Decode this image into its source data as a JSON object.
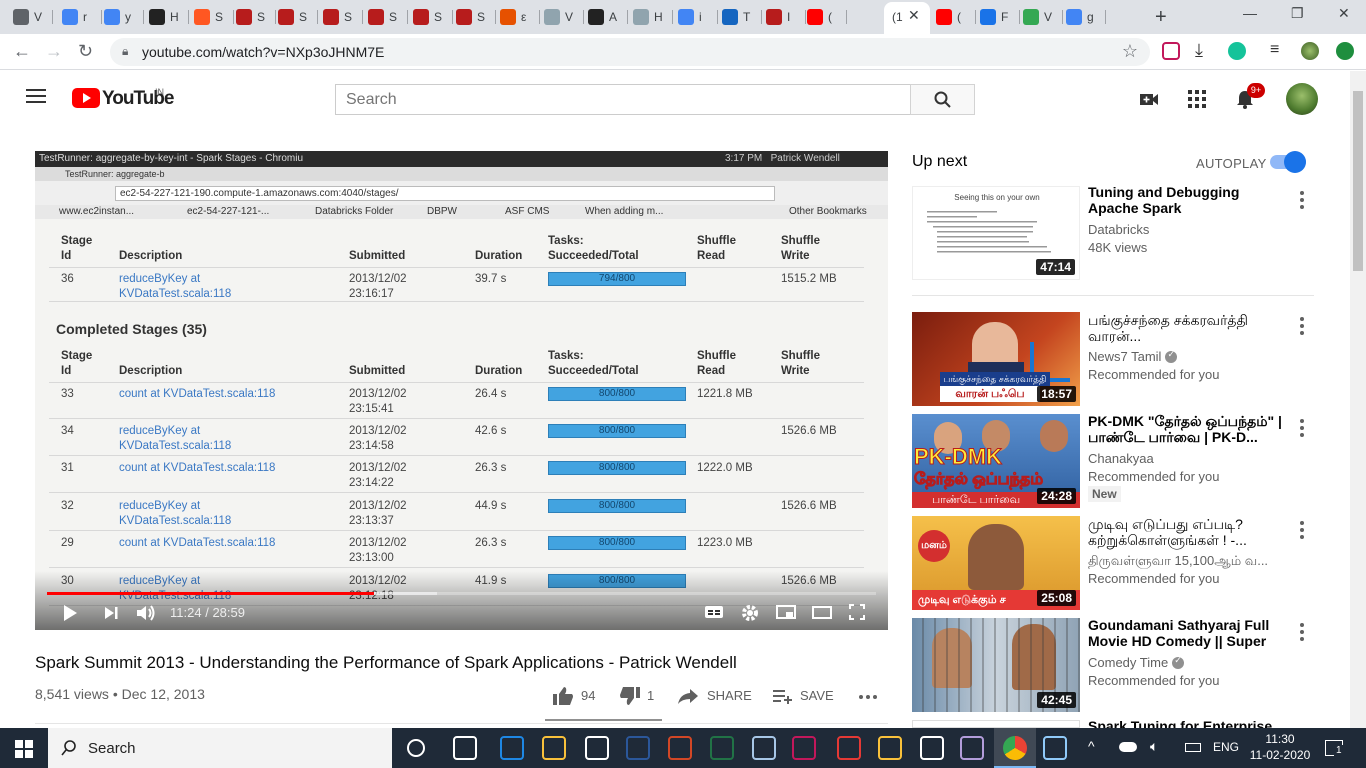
{
  "browser": {
    "active_tab_prefix": "(1",
    "tab_title_glyphs": [
      "V",
      "r",
      "y",
      "H",
      "S",
      "S",
      "S",
      "S",
      "S",
      "S",
      "S",
      "ε",
      "V",
      "A",
      "H",
      "i",
      "T",
      "I",
      "(",
      "(",
      "(",
      "F",
      "V",
      "g"
    ],
    "url": "youtube.com/watch?v=NXp3oJHNM7E"
  },
  "youtube": {
    "logo_text": "YouTube",
    "region": "IN",
    "search_placeholder": "Search",
    "notification_count": "9+"
  },
  "video": {
    "screen": {
      "window_title": "TestRunner: aggregate-by-key-int - Spark Stages - Chromiu",
      "clock": "3:17 PM",
      "user": "Patrick Wendell",
      "tab": "TestRunner: aggregate-b",
      "url": "ec2-54-227-121-190.compute-1.amazonaws.com:4040/stages/",
      "bookmarks": [
        "www.ec2instan...",
        "ec2-54-227-121-...",
        "Databricks Folder",
        "DBPW",
        "ASF CMS",
        "When adding m...",
        "Other Bookmarks"
      ],
      "headers": [
        "Stage Id",
        "Description",
        "Submitted",
        "Duration",
        "Tasks: Succeeded/Total",
        "Shuffle Read",
        "Shuffle Write"
      ],
      "active_row": {
        "id": "36",
        "desc": "reduceByKey at KVDataTest.scala:118",
        "submitted": "2013/12/02 23:16:17",
        "duration": "39.7 s",
        "tasks": "794/800",
        "read": "",
        "write": "1515.2 MB"
      },
      "completed_title": "Completed Stages (35)",
      "rows": [
        {
          "id": "33",
          "desc": "count at KVDataTest.scala:118",
          "submitted": "2013/12/02 23:15:41",
          "duration": "26.4 s",
          "tasks": "800/800",
          "read": "1221.8 MB",
          "write": ""
        },
        {
          "id": "34",
          "desc": "reduceByKey at KVDataTest.scala:118",
          "submitted": "2013/12/02 23:14:58",
          "duration": "42.6 s",
          "tasks": "800/800",
          "read": "",
          "write": "1526.6 MB"
        },
        {
          "id": "31",
          "desc": "count at KVDataTest.scala:118",
          "submitted": "2013/12/02 23:14:22",
          "duration": "26.3 s",
          "tasks": "800/800",
          "read": "1222.0 MB",
          "write": ""
        },
        {
          "id": "32",
          "desc": "reduceByKey at KVDataTest.scala:118",
          "submitted": "2013/12/02 23:13:37",
          "duration": "44.9 s",
          "tasks": "800/800",
          "read": "",
          "write": "1526.6 MB"
        },
        {
          "id": "29",
          "desc": "count at KVDataTest.scala:118",
          "submitted": "2013/12/02 23:13:00",
          "duration": "26.3 s",
          "tasks": "800/800",
          "read": "1223.0 MB",
          "write": ""
        },
        {
          "id": "30",
          "desc": "reduceByKey at KVDataTest.scala:118",
          "submitted": "2013/12/02 23:12:18",
          "duration": "41.9 s",
          "tasks": "800/800",
          "read": "",
          "write": "1526.6 MB"
        }
      ]
    },
    "progress_played_fraction": 0.394,
    "time_current": "11:24",
    "time_separator": "/",
    "time_total": "28:59",
    "title": "Spark Summit 2013 - Understanding the Performance of Spark Applications - Patrick Wendell",
    "views": "8,541 views",
    "meta_separator": "•",
    "date": "Dec 12, 2013",
    "likes": "94",
    "dislikes": "1",
    "share_label": "SHARE",
    "save_label": "SAVE"
  },
  "sidebar": {
    "up_next_label": "Up next",
    "autoplay_label": "AUTOPLAY",
    "autoplay_on": true,
    "first_thumb_heading": "Seeing this on your own",
    "items": [
      {
        "title": "Tuning and Debugging Apache Spark",
        "channel": "Databricks",
        "meta": "48K views",
        "duration": "47:14"
      },
      {
        "title": "பங்குச்சந்தை சக்கரவர்த்தி வாரன்...",
        "channel": "News7 Tamil",
        "meta": "Recommended for you",
        "duration": "18:57",
        "thumb_caption": "பங்குச்சந்தை சக்கரவர்த்தி",
        "thumb_caption2": "வாரன் பஃபெ"
      },
      {
        "title": "PK-DMK \"தேர்தல் ஒப்பந்தம்\" | பாண்டே பார்வை | PK-D...",
        "channel": "Chanakyaa",
        "meta": "Recommended for you",
        "badge": "New",
        "duration": "24:28",
        "thumb_caption": "PK-DMK",
        "thumb_caption2": "தேர்தல் ஒப்பந்தம்",
        "thumb_caption3": "பாண்டே பார்வை"
      },
      {
        "title": "முடிவு எடுப்பது எப்படி? கற்றுக்கொள்ளுங்கள் ! -...",
        "channel": "திருவள்ளுவா 15,100ஆம் வ...",
        "meta": "Recommended for you",
        "duration": "25:08",
        "thumb_caption": "மனம்",
        "thumb_caption2": "முடிவு எடுக்கும் ச"
      },
      {
        "title": "Goundamani Sathyaraj Full Movie HD Comedy || Super Hit...",
        "channel": "Comedy Time",
        "meta": "Recommended for you",
        "duration": "42:45"
      },
      {
        "title": "Spark Tuning for Enterprise"
      }
    ]
  },
  "taskbar": {
    "search_label": "Search",
    "language": "ENG",
    "time": "11:30",
    "date": "11-02-2020",
    "notification_count": "1"
  },
  "colors": {
    "youtube_red": "#ff0000",
    "link_blue": "#1a73e8",
    "taskbar": "#1f2a38"
  }
}
